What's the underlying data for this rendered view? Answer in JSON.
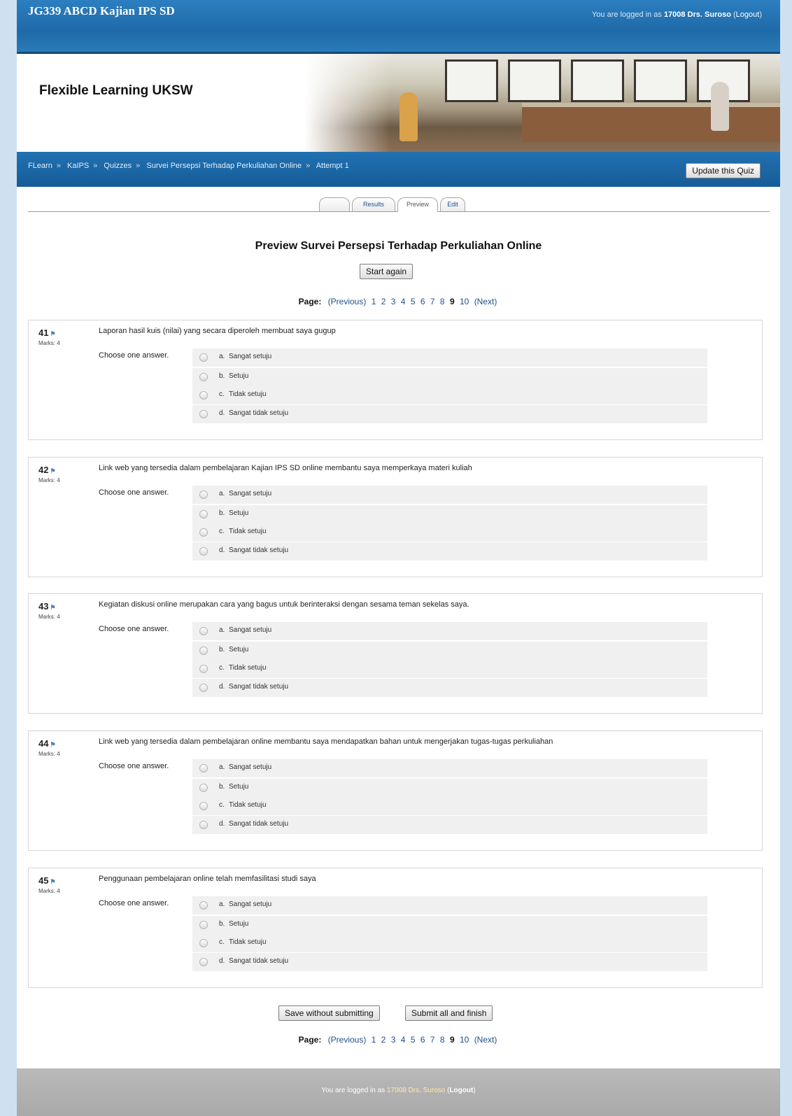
{
  "header": {
    "course_title": "JG339 ABCD Kajian IPS SD",
    "login_prefix": "You are logged in as",
    "user": "17008 Drs. Suroso",
    "logout": "Logout",
    "site_name": "Flexible Learning UKSW"
  },
  "breadcrumb": [
    "FLearn",
    "KaIPS",
    "Quizzes",
    "Survei Persepsi Terhadap Perkuliahan Online",
    "Attempt 1"
  ],
  "breadcrumb_sep": "»",
  "update_button": "Update this Quiz",
  "tabs": [
    {
      "label": ""
    },
    {
      "label": "Results"
    },
    {
      "label": "Preview"
    },
    {
      "label": "Edit"
    }
  ],
  "main": {
    "title": "Preview Survei Persepsi Terhadap Perkuliahan Online",
    "start_again": "Start again"
  },
  "pager": {
    "label": "Page:",
    "previous": "(Previous)",
    "pages": [
      "1",
      "2",
      "3",
      "4",
      "5",
      "6",
      "7",
      "8",
      "9",
      "10"
    ],
    "current": "9",
    "next": "(Next)"
  },
  "questions": [
    {
      "number": "41",
      "marks": "Marks: 4",
      "text": "Laporan hasil kuis (nilai) yang secara diperoleh membuat saya gugup",
      "prompt": "Choose one answer.",
      "options": [
        {
          "letter": "a.",
          "text": "Sangat setuju"
        },
        {
          "letter": "b.",
          "text": "Setuju"
        },
        {
          "letter": "c.",
          "text": "Tidak setuju"
        },
        {
          "letter": "d.",
          "text": "Sangat tidak setuju"
        }
      ]
    },
    {
      "number": "42",
      "marks": "Marks: 4",
      "text": "Link web yang tersedia dalam pembelajaran Kajian IPS SD online membantu saya memperkaya materi kuliah",
      "prompt": "Choose one answer.",
      "options": [
        {
          "letter": "a.",
          "text": "Sangat setuju"
        },
        {
          "letter": "b.",
          "text": "Setuju"
        },
        {
          "letter": "c.",
          "text": "Tidak setuju"
        },
        {
          "letter": "d.",
          "text": "Sangat tidak setuju"
        }
      ]
    },
    {
      "number": "43",
      "marks": "Marks: 4",
      "text": "Kegiatan diskusi online merupakan cara yang bagus untuk berinteraksi dengan sesama teman sekelas saya.",
      "prompt": "Choose one answer.",
      "options": [
        {
          "letter": "a.",
          "text": "Sangat setuju"
        },
        {
          "letter": "b.",
          "text": "Setuju"
        },
        {
          "letter": "c.",
          "text": "Tidak setuju"
        },
        {
          "letter": "d.",
          "text": "Sangat tidak setuju"
        }
      ]
    },
    {
      "number": "44",
      "marks": "Marks: 4",
      "text": "Link web yang tersedia dalam pembelajaran online membantu saya mendapatkan bahan untuk mengerjakan tugas-tugas perkuliahan",
      "prompt": "Choose one answer.",
      "options": [
        {
          "letter": "a.",
          "text": "Sangat setuju"
        },
        {
          "letter": "b.",
          "text": "Setuju"
        },
        {
          "letter": "c.",
          "text": "Tidak setuju"
        },
        {
          "letter": "d.",
          "text": "Sangat tidak setuju"
        }
      ]
    },
    {
      "number": "45",
      "marks": "Marks: 4",
      "text": "Penggunaan pembelajaran online telah memfasilitasi studi saya",
      "prompt": "Choose one answer.",
      "options": [
        {
          "letter": "a.",
          "text": "Sangat setuju"
        },
        {
          "letter": "b.",
          "text": "Setuju"
        },
        {
          "letter": "c.",
          "text": "Tidak setuju"
        },
        {
          "letter": "d.",
          "text": "Sangat tidak setuju"
        }
      ]
    }
  ],
  "actions": {
    "save": "Save without submitting",
    "submit": "Submit all and finish"
  },
  "footer": {
    "login_prefix": "You are logged in as",
    "user": "17008 Drs. Suroso",
    "logout": "Logout"
  },
  "colors": {
    "header_blue": "#1f6aa8",
    "link_blue": "#1d4f8d",
    "footer_gray": "#b0b0b0"
  },
  "icons": {
    "question_flag": "flag-icon",
    "answer_radio": "radio-button"
  }
}
